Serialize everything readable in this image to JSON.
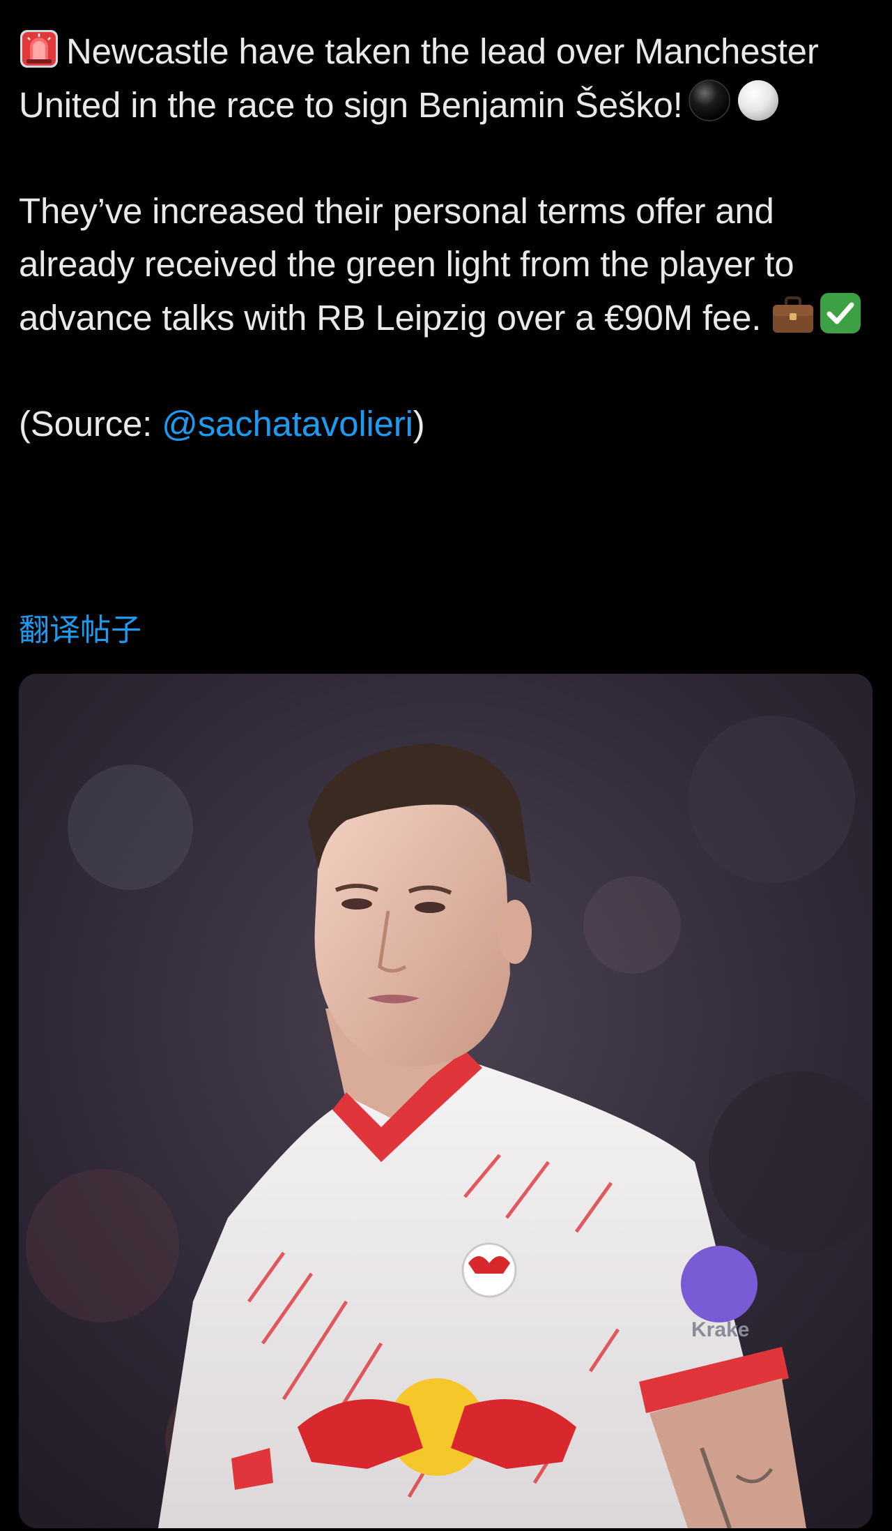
{
  "post": {
    "line1": "Newcastle have taken the lead over Manchester United in the race to sign Benjamin Šeško!",
    "line2": "They’ve increased their personal terms offer and already received the green light from the player to advance talks with RB Leipzig over a €90M fee.",
    "source_prefix": "(Source: ",
    "source_handle": "@sachatavolieri",
    "source_suffix": ")"
  },
  "translate_label": "翻译帖子",
  "media": {
    "alt": "Benjamin Šeško in RB Leipzig white and red shirt",
    "jersey_sponsor": "Krake"
  },
  "icons": {
    "line1_start": "siren-icon",
    "line1_end": [
      "black-circle-icon",
      "white-circle-icon"
    ],
    "line2_end": [
      "briefcase-icon",
      "check-mark-button-icon"
    ]
  },
  "colors": {
    "background": "#000000",
    "text": "#e7e9ea",
    "link": "#1d9bf0"
  }
}
